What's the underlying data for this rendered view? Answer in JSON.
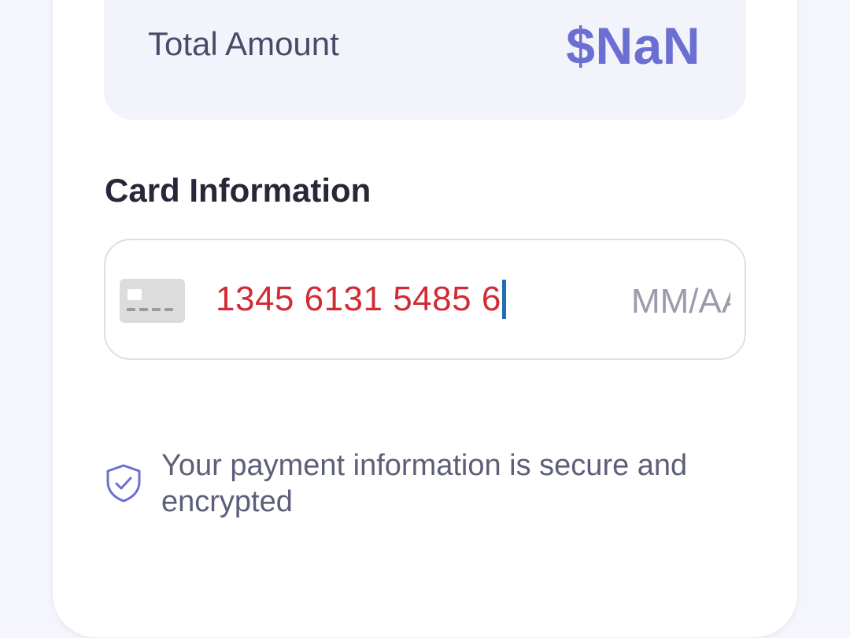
{
  "summary": {
    "total_label": "Total Amount",
    "total_value": "$NaN"
  },
  "card_section": {
    "title": "Card Information",
    "card_number_value": "1345 6131 5485 6",
    "expiry_placeholder": "MM/AA",
    "card_icon": "credit-card-icon"
  },
  "security": {
    "message": "Your payment information is secure and encrypted",
    "icon": "shield-check-icon"
  },
  "colors": {
    "accent": "#6b6fd1",
    "error_text": "#d22b34",
    "caret": "#1f6fb0"
  }
}
